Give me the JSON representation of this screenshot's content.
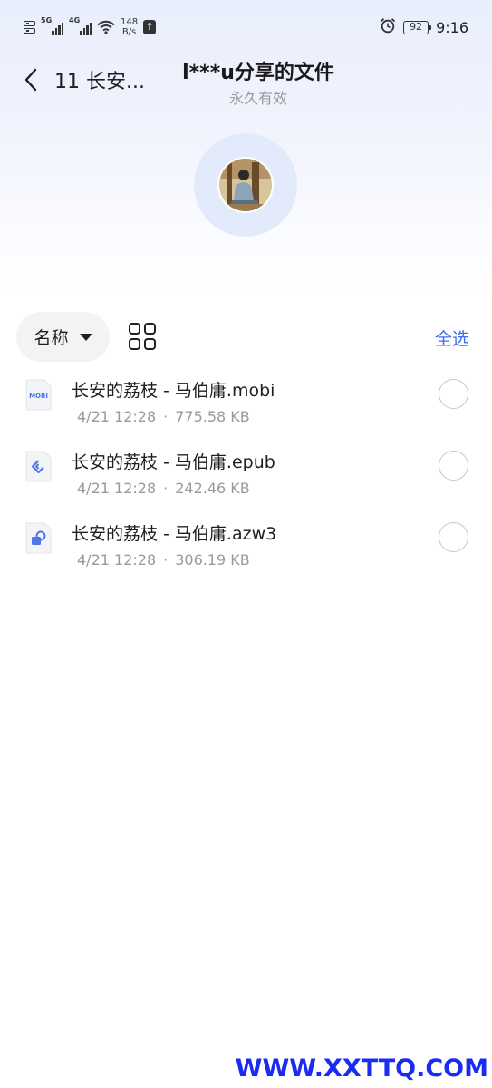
{
  "status_bar": {
    "sim1_network": "5G",
    "sim2_network": "4G",
    "net_speed_value": "148",
    "net_speed_unit": "B/s",
    "battery_level": "92",
    "time": "9:16",
    "icons": [
      "sim-card-icon",
      "signal-icon",
      "wifi-icon",
      "upload-icon",
      "alarm-icon",
      "battery-icon"
    ]
  },
  "header": {
    "back_title": "11 长安...",
    "share_title": "l***u分享的文件",
    "share_subtitle": "永久有效"
  },
  "toolbar": {
    "sort_label": "名称",
    "select_all_label": "全选"
  },
  "files": [
    {
      "name": "长安的荔枝 - 马伯庸.mobi",
      "date": "4/21 12:28",
      "size": "775.58 KB",
      "icon": "mobi-file-icon",
      "icon_label": "MOBI"
    },
    {
      "name": "长安的荔枝 - 马伯庸.epub",
      "date": "4/21 12:28",
      "size": "242.46 KB",
      "icon": "epub-file-icon"
    },
    {
      "name": "长安的荔枝 - 马伯庸.azw3",
      "date": "4/21 12:28",
      "size": "306.19 KB",
      "icon": "azw3-file-icon"
    }
  ],
  "watermark": "WWW.XXTTQ.COM",
  "colors": {
    "accent": "#3d6df2",
    "hero_bg": "#e9eefc",
    "avatar_ring": "#e3eafb",
    "watermark": "#1a2cf2"
  }
}
